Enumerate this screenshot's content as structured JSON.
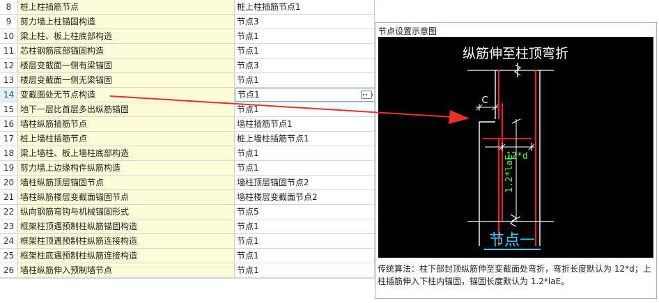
{
  "table": {
    "rows": [
      {
        "num": "8",
        "name": "桩上柱插筋节点",
        "value": "桩上柱插筋节点1"
      },
      {
        "num": "9",
        "name": "剪力墙上柱锚固构造",
        "value": "节点3"
      },
      {
        "num": "10",
        "name": "梁上柱、板上柱底部构造",
        "value": "节点1"
      },
      {
        "num": "11",
        "name": "芯柱钢筋底部锚固构造",
        "value": "节点1"
      },
      {
        "num": "12",
        "name": "楼层变截面一侧有梁锚固",
        "value": "节点3"
      },
      {
        "num": "13",
        "name": "楼层变截面一侧无梁锚固",
        "value": "节点1"
      },
      {
        "num": "14",
        "name": "变截面处无节点构造",
        "value": "节点1"
      },
      {
        "num": "15",
        "name": "地下一层比首层多出纵筋锚固",
        "value": "节点1"
      },
      {
        "num": "16",
        "name": "墙柱纵筋插筋节点",
        "value": "墙柱插筋节点1"
      },
      {
        "num": "17",
        "name": "桩上墙柱插筋节点",
        "value": "桩上墙柱插筋节点1"
      },
      {
        "num": "18",
        "name": "梁上墙柱、板上墙柱底部构造",
        "value": "节点1"
      },
      {
        "num": "19",
        "name": "剪力墙上边缘构件纵筋构造",
        "value": "节点1"
      },
      {
        "num": "20",
        "name": "墙柱纵筋顶层锚固节点",
        "value": "墙柱顶层锚固节点2"
      },
      {
        "num": "21",
        "name": "墙柱纵筋楼层变截面锚固节点",
        "value": "墙柱楼层变截面节点2"
      },
      {
        "num": "22",
        "name": "纵向钢筋弯钩与机械锚固形式",
        "value": "节点5"
      },
      {
        "num": "23",
        "name": "框架柱顶遇预制柱纵筋锚固构造",
        "value": "节点1"
      },
      {
        "num": "24",
        "name": "框架柱顶遇预制柱纵筋连接构造",
        "value": "节点1"
      },
      {
        "num": "25",
        "name": "框架柱底遇预制柱纵筋连接构造",
        "value": "节点1"
      },
      {
        "num": "26",
        "name": "墙柱纵筋伸入预制墙节点",
        "value": "节点1"
      }
    ],
    "selected_row": "14"
  },
  "panel": {
    "title": "节点设置示意图",
    "diagram": {
      "heading": "纵筋伸至柱顶弯折",
      "label_c": "C",
      "label_bend": "12*d",
      "label_anchor": "1.2*laE",
      "caption": "节点一"
    },
    "description": "传统算法：柱下部封顶纵筋伸至变截面处弯折，弯折长度默认为 12*d；上柱插筋伸入下柱内锚固，锚固长度默认为 1.2*laE。"
  },
  "colors": {
    "row_name_bg": "#fdfcd9",
    "diagram_bg": "#000000",
    "rebar_red": "#ff1a1a",
    "dim_green": "#3cff3c",
    "caption_cyan": "#2fd0ff",
    "annotation_arrow": "#e8312a"
  }
}
